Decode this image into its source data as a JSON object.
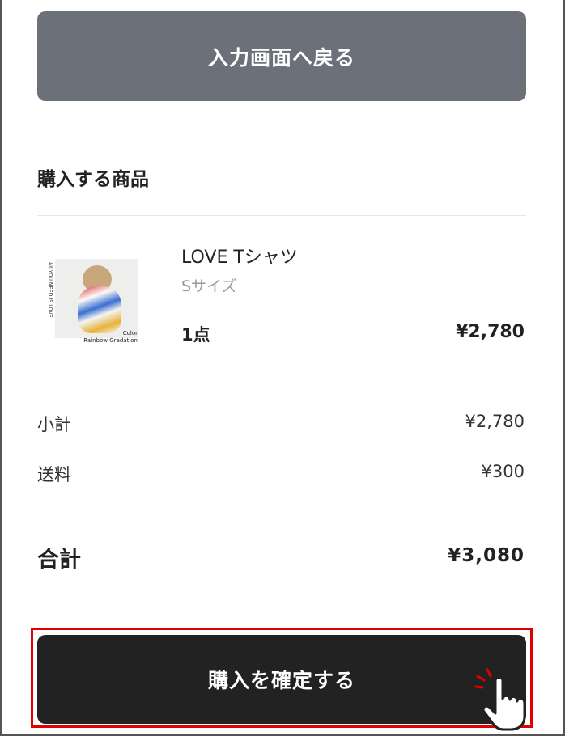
{
  "back_button": {
    "label": "入力画面へ戻る"
  },
  "section": {
    "title": "購入する商品"
  },
  "product": {
    "name": "LOVE Tシャツ",
    "size": "Sサイズ",
    "quantity": "1点",
    "price": "¥2,780",
    "image_text": {
      "side": "All YOU NEED IS LOVE",
      "color_line1": "Color",
      "color_line2": "Rainbow Gradation"
    }
  },
  "summary": {
    "subtotal_label": "小計",
    "subtotal_value": "¥2,780",
    "shipping_label": "送料",
    "shipping_value": "¥300"
  },
  "total": {
    "label": "合計",
    "value": "¥3,080"
  },
  "confirm_button": {
    "label": "購入を確定する"
  },
  "colors": {
    "back_button_bg": "#6b7079",
    "confirm_button_bg": "#222222",
    "highlight_outline": "#e00000"
  }
}
